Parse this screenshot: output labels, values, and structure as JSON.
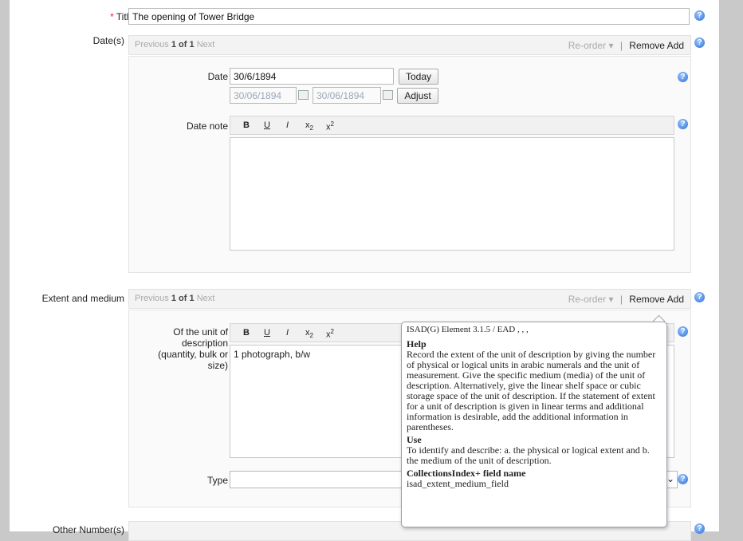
{
  "title_field": {
    "required_mark": "*",
    "label": "Title",
    "value": "The opening of Tower Bridge"
  },
  "dates": {
    "label": "Date(s)",
    "nav": {
      "previous": "Previous",
      "current": "1",
      "of": "of",
      "total": "1",
      "next": "Next"
    },
    "actions": {
      "reorder": "Re-order",
      "remove": "Remove",
      "add": "Add"
    },
    "date_label": "Date",
    "date_value": "30/6/1894",
    "today_button": "Today",
    "range_start": "30/06/1894",
    "range_end": "30/06/1894",
    "adjust_button": "Adjust",
    "note_label": "Date note"
  },
  "toolbar": {
    "bold": "B",
    "underline": "U",
    "italic": "I",
    "subscript_base": "x",
    "subscript_mark": "2",
    "superscript_base": "x",
    "superscript_mark": "2"
  },
  "extent": {
    "label": "Extent and medium",
    "nav": {
      "previous": "Previous",
      "current": "1",
      "of": "of",
      "total": "1",
      "next": "Next"
    },
    "actions": {
      "reorder": "Re-order",
      "remove": "Remove",
      "add": "Add"
    },
    "unit_label_line1": "Of the unit of",
    "unit_label_line2": "description",
    "unit_label_line3": "(quantity, bulk or",
    "unit_label_line4": "size)",
    "unit_value": "1 photograph, b/w",
    "type_label": "Type"
  },
  "tooltip": {
    "reference": "ISAD(G) Element 3.1.5 / EAD , , ,",
    "help_heading": "Help",
    "help_text": "Record the extent of the unit of description by giving the number of physical or logical units in arabic numerals and the unit of measurement. Give the specific medium (media) of the unit of description. Alternatively, give the linear shelf space or cubic storage space of the unit of description. If the statement of extent for a unit of description is given in linear terms and additional information is desirable, add the additional information in parentheses.",
    "use_heading": "Use",
    "use_text": "To identify and describe: a. the physical or logical extent and b. the medium of the unit of description.",
    "field_heading": "CollectionsIndex+ field name",
    "field_name": "isad_extent_medium_field"
  },
  "other_numbers": {
    "label": "Other Number(s)"
  },
  "icons": {
    "help": "help-icon",
    "calendar": "calendar-icon",
    "dropdown": "chevron-down-icon"
  },
  "colors": {
    "required": "#ee2233",
    "help_icon": "#2d6fd6",
    "page_bg": "#c9c9c9"
  }
}
